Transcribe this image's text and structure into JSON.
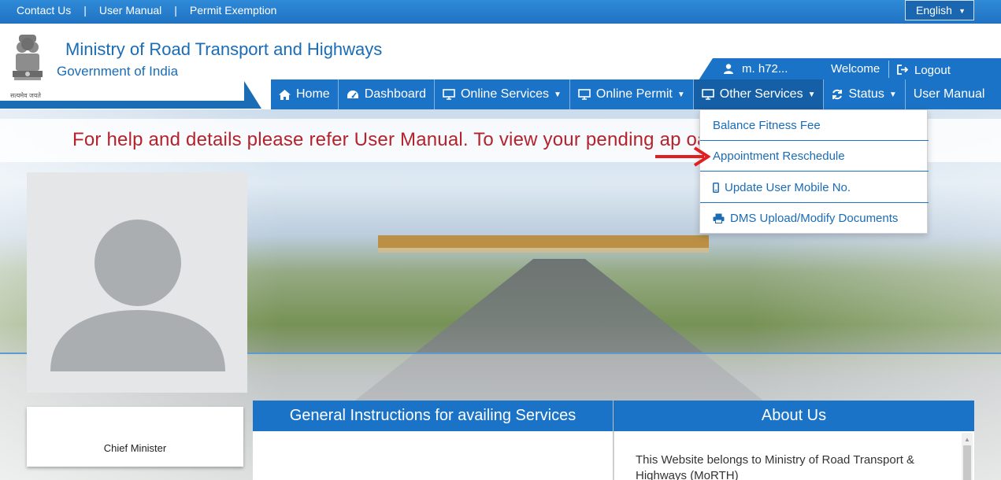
{
  "top_links": [
    "Contact Us",
    "User Manual",
    "Permit Exemption"
  ],
  "language": {
    "selected": "English"
  },
  "brand": {
    "title": "Ministry of Road Transport and Highways",
    "subtitle": "Government of India",
    "emblem_motto": "सत्यमेव जयते"
  },
  "user": {
    "name": "m.           h72...",
    "welcome": "Welcome",
    "logout": "Logout"
  },
  "nav": {
    "home": "Home",
    "dashboard": "Dashboard",
    "online_services": "Online Services",
    "online_permit": "Online Permit",
    "other_services": "Other Services",
    "status": "Status",
    "user_manual": "User Manual"
  },
  "notice": "For help and details please refer User Manual. To view your pending ap                                                    oard\".",
  "dropdown": [
    {
      "label": "Balance Fitness Fee",
      "icon": ""
    },
    {
      "label": "Appointment Reschedule",
      "icon": ""
    },
    {
      "label": "Update User Mobile No.",
      "icon": "mobile-icon"
    },
    {
      "label": "DMS Upload/Modify Documents",
      "icon": "printer-icon"
    }
  ],
  "profile": {
    "caption": "Chief Minister"
  },
  "panels": {
    "instructions_title": "General Instructions for availing Services",
    "about_title": "About Us",
    "about_text": "This Website belongs to Ministry of Road Transport & Highways (MoRTH)"
  },
  "colors": {
    "primary": "#1a73c7",
    "notice_text": "#b5222c",
    "link": "#1a6cb5"
  }
}
